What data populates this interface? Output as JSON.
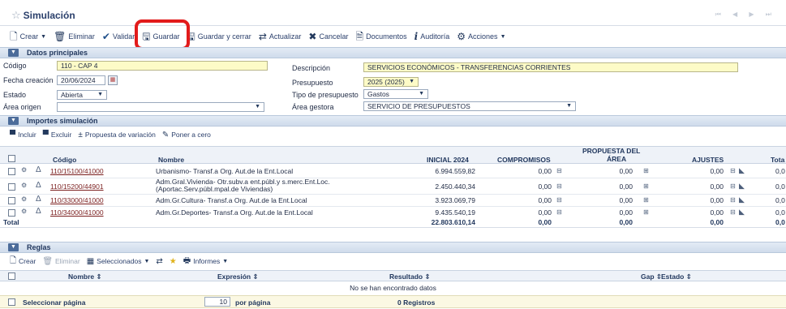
{
  "header": {
    "title": "Simulación",
    "nav": "⏮ ◀ ▶ ⏭"
  },
  "toolbar": {
    "crear": "Crear",
    "eliminar": "Eliminar",
    "validar": "Validar",
    "guardar": "Guardar",
    "guardar_cerrar": "Guardar y cerrar",
    "actualizar": "Actualizar",
    "cancelar": "Cancelar",
    "documentos": "Documentos",
    "auditoria": "Auditoría",
    "acciones": "Acciones"
  },
  "datos": {
    "section_title": "Datos principales",
    "codigo_label": "Código",
    "codigo_value": "110 - CAP 4",
    "fecha_label": "Fecha creación",
    "fecha_value": "20/06/2024",
    "estado_label": "Estado",
    "estado_value": "Abierta",
    "area_origen_label": "Área origen",
    "area_origen_value": "",
    "descripcion_label": "Descripción",
    "descripcion_value": "SERVICIOS ECONÓMICOS - TRANSFERENCIAS CORRIENTES",
    "presupuesto_label": "Presupuesto",
    "presupuesto_value": "2025 (2025)",
    "tipo_label": "Tipo de presupuesto",
    "tipo_value": "Gastos",
    "area_gestora_label": "Área gestora",
    "area_gestora_value": "SERVICIO DE PRESUPUESTOS"
  },
  "importes": {
    "section_title": "Importes simulación",
    "incluir": "Incluir",
    "excluir": "Excluir",
    "propuesta": "Propuesta de variación",
    "poner_cero": "Poner a cero",
    "columns": {
      "codigo": "Código",
      "nombre": "Nombre",
      "inicial": "INICIAL 2024",
      "compromisos": "COMPROMISOS",
      "propuesta_1": "PROPUESTA DEL",
      "propuesta_2": "ÁREA",
      "ajustes": "AJUSTES",
      "total": "Tota"
    },
    "rows": [
      {
        "codigo": "110/15100/41000",
        "nombre_1": "Urbanismo- Transf.a Org. Aut.de la Ent.Local",
        "nombre_2": "",
        "inicial": "6.994.559,82",
        "compromisos": "0,00",
        "propuesta": "0,00",
        "ajustes": "0,00",
        "total": "0,0"
      },
      {
        "codigo": "110/15200/44901",
        "nombre_1": "Adm.Gral.Vivienda- Otr.subv.a ent.públ.y s.merc.Ent.Loc.",
        "nombre_2": "(Aportac.Serv.públ.mpal.de Viviendas)",
        "inicial": "2.450.440,34",
        "compromisos": "0,00",
        "propuesta": "0,00",
        "ajustes": "0,00",
        "total": "0,0"
      },
      {
        "codigo": "110/33000/41000",
        "nombre_1": "Adm.Gr.Cultura- Transf.a Org. Aut.de la Ent.Local",
        "nombre_2": "",
        "inicial": "3.923.069,79",
        "compromisos": "0,00",
        "propuesta": "0,00",
        "ajustes": "0,00",
        "total": "0,0"
      },
      {
        "codigo": "110/34000/41000",
        "nombre_1": "Adm.Gr.Deportes- Transf.a Org. Aut.de la Ent.Local",
        "nombre_2": "",
        "inicial": "9.435.540,19",
        "compromisos": "0,00",
        "propuesta": "0,00",
        "ajustes": "0,00",
        "total": "0,0"
      }
    ],
    "total_label": "Total",
    "totals": {
      "inicial": "22.803.610,14",
      "compromisos": "0,00",
      "propuesta": "0,00",
      "ajustes": "0,00",
      "total": "0,0"
    }
  },
  "reglas": {
    "section_title": "Reglas",
    "crear": "Crear",
    "eliminar": "Eliminar",
    "seleccionados": "Seleccionados",
    "informes": "Informes",
    "col_nombre": "Nombre",
    "col_expresion": "Expresión",
    "col_resultado": "Resultado",
    "col_gap": "Gap",
    "col_estado": "Estado",
    "empty": "No se han encontrado datos",
    "seleccionar": "Seleccionar página",
    "per_page_value": "10",
    "per_page_label": "por página",
    "registros": "0 Registros"
  }
}
